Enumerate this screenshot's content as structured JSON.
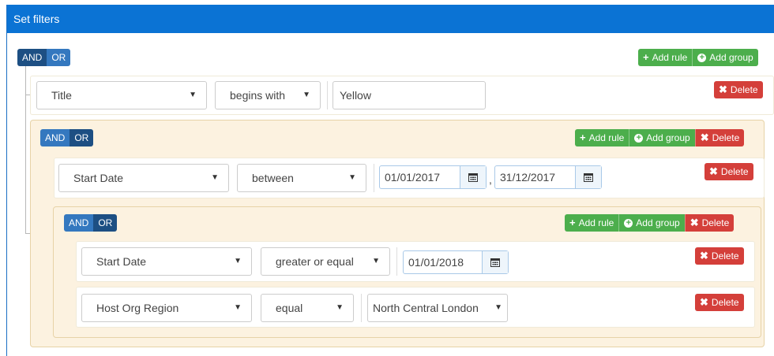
{
  "header": {
    "title": "Set filters"
  },
  "labels": {
    "and": "AND",
    "or": "OR",
    "add_rule": "Add rule",
    "add_group": "Add group",
    "delete": "Delete"
  },
  "rule1": {
    "field": "Title",
    "operator": "begins with",
    "value": "Yellow"
  },
  "rule2": {
    "field": "Start Date",
    "operator": "between",
    "value_from": "01/01/2017",
    "separator": ",",
    "value_to": "31/12/2017"
  },
  "rule3": {
    "field": "Start Date",
    "operator": "greater or equal",
    "value": "01/01/2018"
  },
  "rule4": {
    "field": "Host Org Region",
    "operator": "equal",
    "value": "North Central London"
  },
  "colors": {
    "header": "#0b73d4",
    "and_active": "#1d4f83",
    "or": "#3478bf",
    "green": "#4cae4c",
    "red": "#d43f3a",
    "group_bg": "#fcf2e0"
  },
  "icons": [
    "plus-icon",
    "plus-circle-icon",
    "times-icon",
    "calendar-icon",
    "caret-down-icon"
  ]
}
